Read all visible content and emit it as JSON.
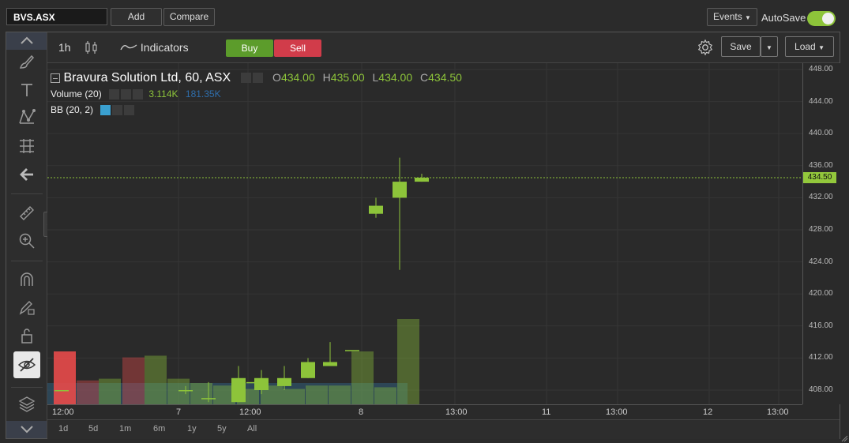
{
  "topbar": {
    "symbol": "BVS.ASX",
    "add_label": "Add",
    "compare_label": "Compare",
    "events_label": "Events",
    "autosave_label": "AutoSave",
    "autosave_on": true
  },
  "chart_toolbar": {
    "interval": "1h",
    "indicators_label": "Indicators",
    "buy_label": "Buy",
    "sell_label": "Sell",
    "save_label": "Save",
    "load_label": "Load"
  },
  "legend": {
    "title": "Bravura Solution Ltd, 60, ASX",
    "open_key": "O",
    "open": "434.00",
    "high_key": "H",
    "high": "435.00",
    "low_key": "L",
    "low": "434.00",
    "close_key": "C",
    "close": "434.50",
    "volume_label": "Volume (20)",
    "volume_value": "3.114K",
    "volume_ma": "181.35K",
    "bb_label": "BB (20, 2)"
  },
  "price_axis": [
    "448.00",
    "444.00",
    "440.00",
    "436.00",
    "432.00",
    "428.00",
    "424.00",
    "420.00",
    "416.00",
    "412.00",
    "408.00"
  ],
  "last_price": "434.50",
  "time_axis": [
    "12:00",
    "7",
    "12:00",
    "8",
    "13:00",
    "11",
    "13:00",
    "12",
    "13:00"
  ],
  "ranges": [
    "1d",
    "5d",
    "1m",
    "6m",
    "1y",
    "5y",
    "All"
  ],
  "colors": {
    "up": "#8dc43a",
    "down": "#e84a4a",
    "accent": "#8dc43a",
    "vol_up": "#4a7a3a",
    "vol_down": "#8a3a3a",
    "bb_fill": "#2f5c7a"
  },
  "chart_data": {
    "type": "candlestick",
    "ylim": [
      406,
      450
    ],
    "candles": [
      {
        "o": 408.0,
        "h": 408.0,
        "l": 408.0,
        "c": 408.0
      },
      {
        "o": 408.0,
        "h": 408.5,
        "l": 407.5,
        "c": 408.0
      },
      {
        "o": 407.0,
        "h": 409.0,
        "l": 406.5,
        "c": 407.0
      },
      {
        "o": 406.5,
        "h": 411.0,
        "l": 406.5,
        "c": 409.5
      },
      {
        "o": 409.0,
        "h": 409.0,
        "l": 409.0,
        "c": 409.0
      },
      {
        "o": 408.0,
        "h": 410.5,
        "l": 407.5,
        "c": 409.5
      },
      {
        "o": 408.5,
        "h": 411.0,
        "l": 408.0,
        "c": 409.5
      },
      {
        "o": 409.5,
        "h": 412.0,
        "l": 409.5,
        "c": 411.5
      },
      {
        "o": 411.0,
        "h": 414.0,
        "l": 411.0,
        "c": 411.5
      },
      {
        "o": 413.0,
        "h": 413.0,
        "l": 413.0,
        "c": 413.0
      },
      {
        "o": 430.0,
        "h": 432.0,
        "l": 429.5,
        "c": 431.0
      },
      {
        "o": 432.0,
        "h": 437.0,
        "l": 423.0,
        "c": 434.0
      },
      {
        "o": 434.0,
        "h": 435.0,
        "l": 434.0,
        "c": 434.5
      }
    ],
    "volumes": [
      {
        "v": 0.62,
        "d": "down"
      },
      {
        "v": 0.38,
        "d": "down"
      },
      {
        "v": 0.55,
        "d": "up"
      },
      {
        "v": 0.55,
        "d": "up"
      },
      {
        "v": 0.25,
        "d": "up"
      },
      {
        "v": 0.25,
        "d": "up"
      },
      {
        "v": 0.4,
        "d": "up"
      },
      {
        "v": 0.3,
        "d": "up"
      },
      {
        "v": 0.45,
        "d": "up"
      },
      {
        "v": 0.62,
        "d": "up"
      },
      {
        "v": 1.0,
        "d": "up"
      }
    ]
  }
}
